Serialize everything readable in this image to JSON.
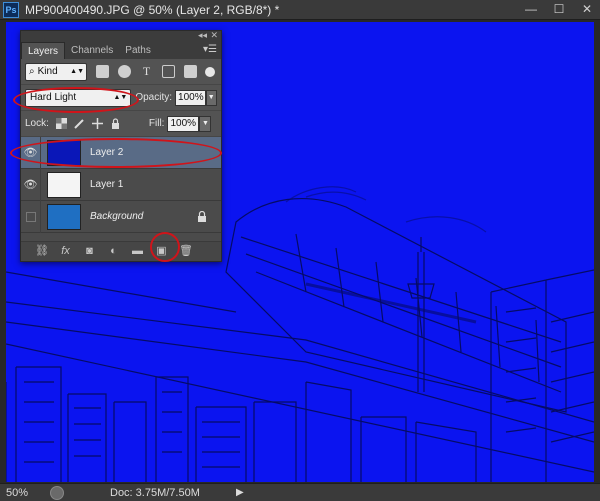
{
  "app": {
    "logo": "Ps"
  },
  "document": {
    "title": "MP900400490.JPG @ 50% (Layer 2, RGB/8*) *"
  },
  "window_controls": {
    "minimize": "—",
    "maximize": "☐",
    "close": "✕"
  },
  "panel": {
    "collapse_label": "◂◂",
    "close_label": "✕",
    "menu_label": "▾☰",
    "tabs": [
      {
        "label": "Layers",
        "active": true
      },
      {
        "label": "Channels",
        "active": false
      },
      {
        "label": "Paths",
        "active": false
      }
    ],
    "filter": {
      "kind_label": "Kind",
      "icons": [
        "pixel-filter-icon",
        "adjustment-filter-icon",
        "type-filter-icon",
        "shape-filter-icon",
        "smart-object-filter-icon"
      ],
      "type_glyph": "T"
    },
    "blend": {
      "mode": "Hard Light",
      "opacity_label": "Opacity:",
      "opacity_value": "100%"
    },
    "lock": {
      "label": "Lock:",
      "fill_label": "Fill:",
      "fill_value": "100%"
    },
    "layers": [
      {
        "name": "Layer 2",
        "selected": true,
        "visible": true,
        "thumb_color": "#0a17b8"
      },
      {
        "name": "Layer 1",
        "selected": false,
        "visible": true,
        "thumb_color": "#f4f4f4"
      },
      {
        "name": "Background",
        "selected": false,
        "visible": false,
        "thumb_color": "#1f6fc2",
        "locked": true
      }
    ],
    "footer": {
      "link": "⛓",
      "fx": "fx",
      "mask": "◙",
      "adjust": "◐",
      "group": "▬",
      "new_layer": "▣",
      "trash": "🗑"
    }
  },
  "status": {
    "zoom": "50%",
    "doc_info": "Doc: 3.75M/7.50M",
    "arrow": "▶"
  },
  "colors": {
    "canvas": "#0b14f0",
    "highlight": "#d0141a",
    "selected_layer": "#596b86"
  }
}
